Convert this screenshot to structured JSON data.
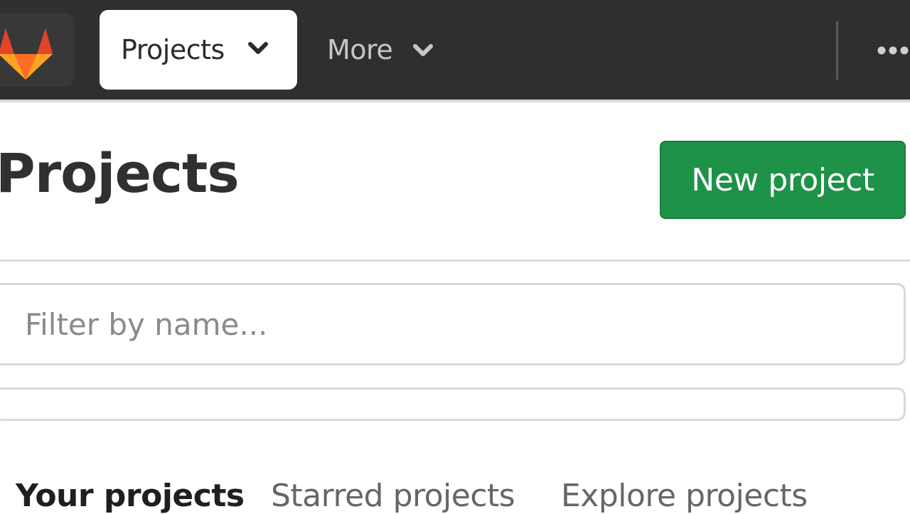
{
  "topbar": {
    "nav": {
      "projects_label": "Projects",
      "more_label": "More"
    },
    "logo_icon": "gitlab-tanuki-icon",
    "more_actions_icon": "ellipsis-icon"
  },
  "header": {
    "title": "Projects",
    "new_project_label": "New project"
  },
  "filter": {
    "placeholder": "Filter by name...",
    "value": ""
  },
  "tabs": [
    {
      "label": "Your projects",
      "active": true
    },
    {
      "label": "Starred projects",
      "active": false
    },
    {
      "label": "Explore projects",
      "active": false
    }
  ],
  "colors": {
    "topbar_bg": "#2f2f2f",
    "primary_button": "#1f9249",
    "logo_orange": "#fc6d26",
    "logo_red": "#e24329",
    "logo_amber": "#fca326"
  }
}
